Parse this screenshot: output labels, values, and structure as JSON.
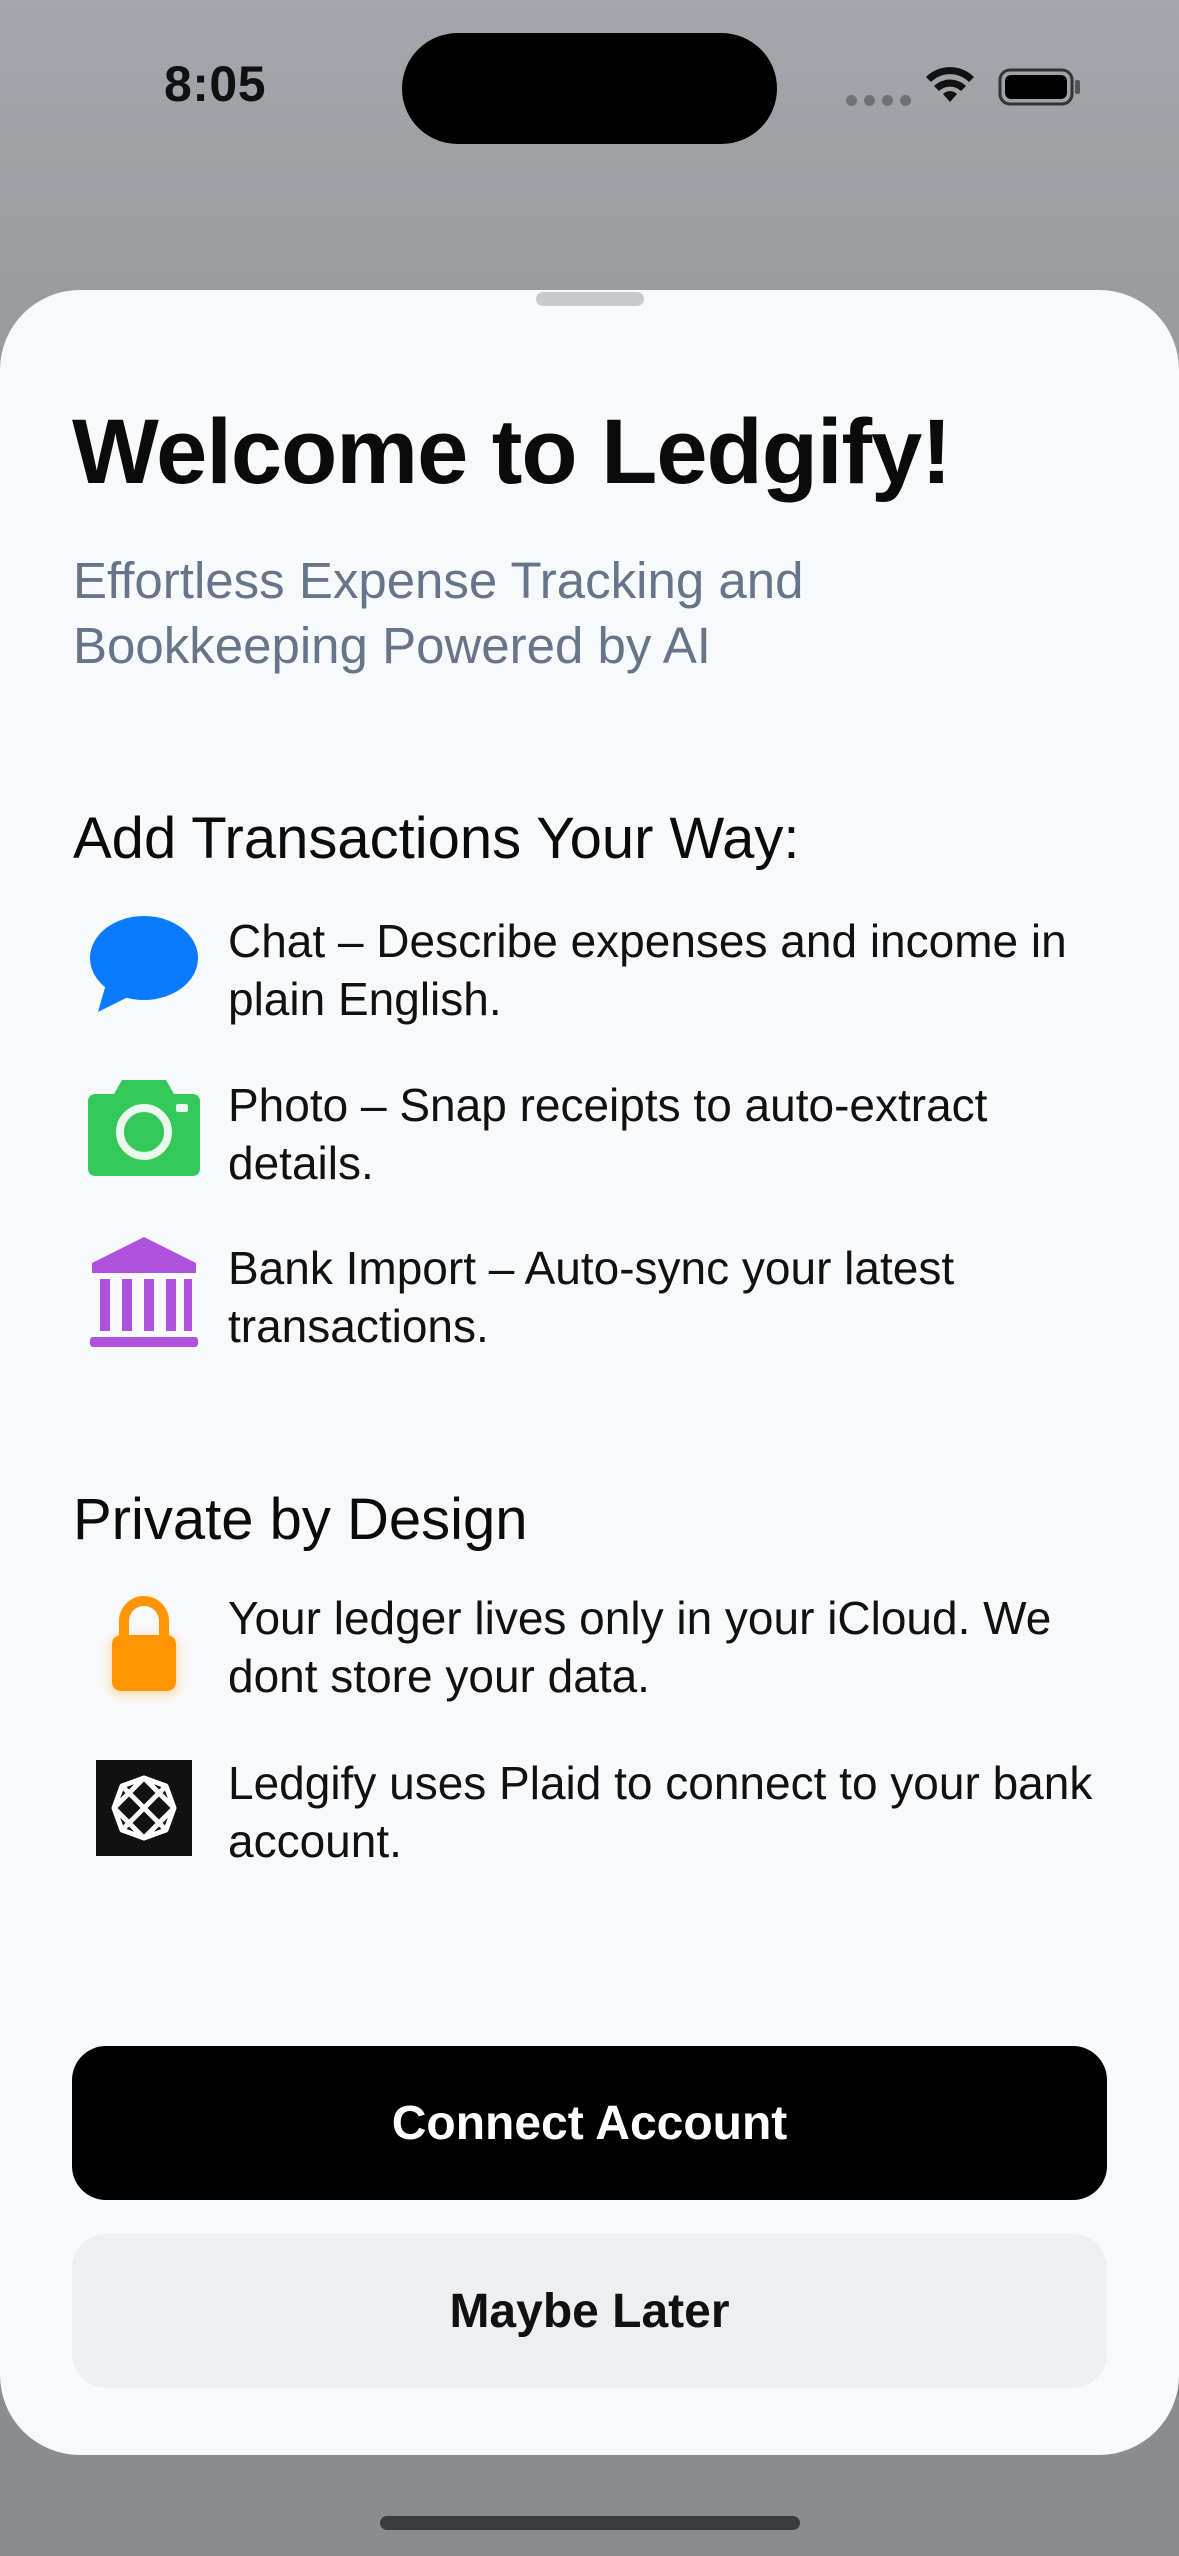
{
  "status_bar": {
    "time": "8:05"
  },
  "welcome": {
    "title": "Welcome to Ledgify!",
    "subtitle": "Effortless Expense Tracking and Bookkeeping Powered by AI"
  },
  "sections": {
    "transactions_heading": "Add Transactions Your Way:",
    "privacy_heading": "Private by Design"
  },
  "features": [
    {
      "icon": "chat-bubble-icon",
      "color": "#0a7aff",
      "text": "Chat – Describe expenses and income in plain English."
    },
    {
      "icon": "camera-icon",
      "color": "#34c759",
      "text": "Photo – Snap receipts to auto-extract details."
    },
    {
      "icon": "bank-building-icon",
      "color": "#af52de",
      "text": "Bank Import – Auto-sync your latest transactions."
    }
  ],
  "privacy_items": [
    {
      "icon": "lock-icon",
      "color": "#ff9500",
      "text": "Your ledger lives only in your iCloud. We dont store your data."
    },
    {
      "icon": "plaid-logo-icon",
      "color": "#111111",
      "text": "Ledgify uses Plaid to connect to your bank account."
    }
  ],
  "buttons": {
    "connect_label": "Connect Account",
    "later_label": "Maybe Later"
  }
}
